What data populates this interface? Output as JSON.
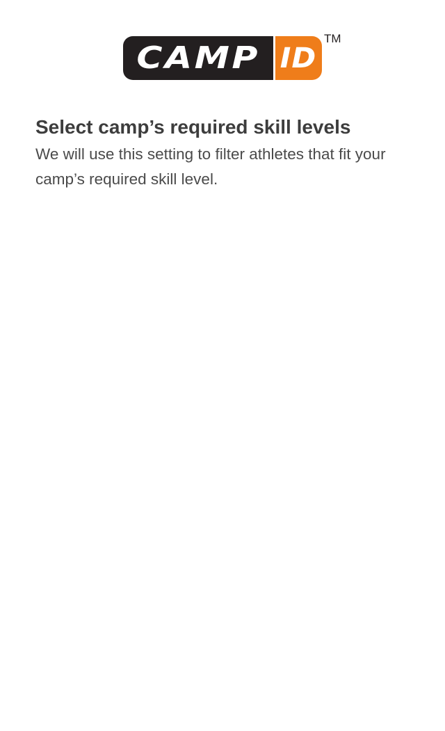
{
  "logo": {
    "text_left": "CAMP",
    "text_right": "ID",
    "trademark": "TM",
    "colors": {
      "dark": "#231f20",
      "accent": "#ef7d1a"
    }
  },
  "page": {
    "title": "Select camp’s required skill levels",
    "description": "We will use this setting to filter athletes that fit your camp’s required skill level."
  }
}
